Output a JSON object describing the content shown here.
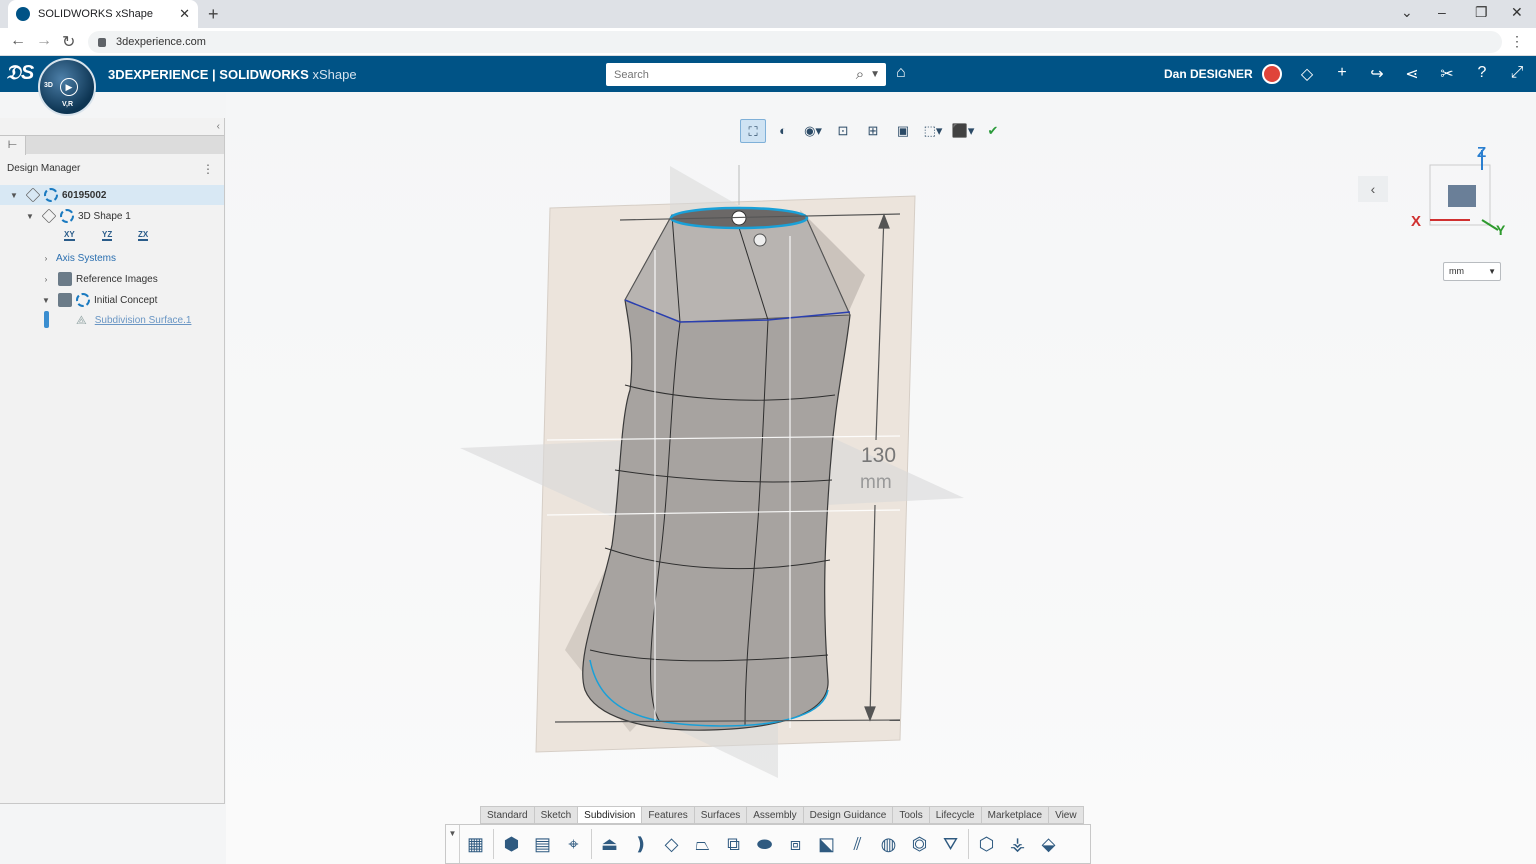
{
  "browser": {
    "tab_title": "SOLIDWORKS xShape",
    "url": "3dexperience.com"
  },
  "header": {
    "brand_main": "3DEXPERIENCE | SOLIDWORKS",
    "brand_app": "xShape",
    "search_placeholder": "Search",
    "user_name": "Dan DESIGNER",
    "compass_top": "3D",
    "compass_bottom": "V,R"
  },
  "left_panel": {
    "title": "Design Manager",
    "tree": [
      {
        "label": "60195002",
        "expanded": true,
        "selected": true
      },
      {
        "label": "3D Shape 1",
        "expanded": true
      },
      {
        "label": "Axis Systems",
        "expanded": false
      },
      {
        "label": "Reference Images",
        "expanded": false
      },
      {
        "label": "Initial Concept",
        "expanded": true
      },
      {
        "label": "Subdivision Surface.1"
      }
    ],
    "plane_labels": [
      "XY",
      "YZ",
      "ZX"
    ]
  },
  "viewport": {
    "dimension_value": "130",
    "dimension_unit": "mm",
    "unit_select": "mm",
    "triad": {
      "x": "X",
      "y": "Y",
      "z": "Z"
    }
  },
  "action_bar": {
    "tabs": [
      "Standard",
      "Sketch",
      "Subdivision",
      "Features",
      "Surfaces",
      "Assembly",
      "Design Guidance",
      "Tools",
      "Lifecycle",
      "Marketplace",
      "View"
    ],
    "active_tab": "Subdivision"
  },
  "colors": {
    "header_bg": "#005386",
    "accent": "#2a6fb0",
    "selection": "#19a0d8"
  }
}
